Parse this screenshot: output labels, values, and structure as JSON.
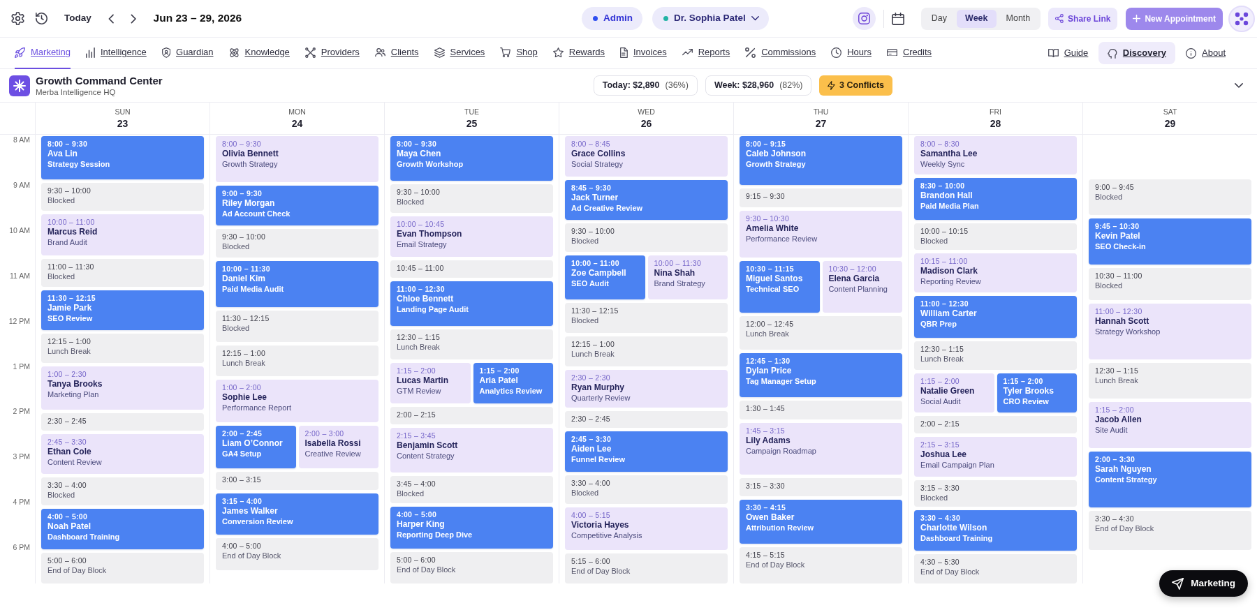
{
  "toolbar": {
    "today_button": "Today",
    "date_range": "Jun 23 – 29, 2026",
    "context_pills": [
      {
        "label": "Admin",
        "color": "#2f4ff0",
        "has_menu": false
      },
      {
        "label": "Dr. Sophia Patel",
        "color": "#22b3a4",
        "has_menu": true
      }
    ],
    "views": [
      {
        "label": "Day",
        "selected": false
      },
      {
        "label": "Week",
        "selected": true
      },
      {
        "label": "Month",
        "selected": false
      }
    ],
    "share_button": "Share Link",
    "new_button": {
      "label": "New Appointment",
      "disabled": true
    }
  },
  "nav": {
    "items": [
      {
        "label": "Marketing",
        "selected": true
      },
      {
        "label": "Intelligence",
        "selected": false
      },
      {
        "label": "Guardian",
        "selected": false
      },
      {
        "label": "Knowledge",
        "selected": false
      },
      {
        "label": "Providers",
        "selected": false
      },
      {
        "label": "Clients",
        "selected": false
      },
      {
        "label": "Services",
        "selected": false
      },
      {
        "label": "Shop",
        "selected": false
      },
      {
        "label": "Rewards",
        "selected": false
      },
      {
        "label": "Invoices",
        "selected": false
      },
      {
        "label": "Reports",
        "selected": false
      },
      {
        "label": "Commissions",
        "selected": false
      },
      {
        "label": "Hours",
        "selected": false
      },
      {
        "label": "Credits",
        "selected": false
      }
    ],
    "right_items": [
      {
        "label": "Guide",
        "highlighted": false
      },
      {
        "label": "Discovery",
        "highlighted": true
      },
      {
        "label": "About",
        "highlighted": false
      }
    ]
  },
  "page_header": {
    "title": "Growth Command Center",
    "subtitle": "Merba Intelligence HQ",
    "stats": [
      {
        "label": "Today: $2,890",
        "share": "(36%)"
      },
      {
        "label": "Week: $28,960",
        "share": "(82%)"
      }
    ],
    "conflicts": "3 Conflicts"
  },
  "time_labels": [
    "8 AM",
    "9 AM",
    "10 AM",
    "11 AM",
    "12 PM",
    "1 PM",
    "2 PM",
    "3 PM",
    "4 PM",
    "6 PM"
  ],
  "days": [
    {
      "weekday": "SUN",
      "date": "23",
      "events": [
        {
          "kind": "confirmed",
          "time": "8:00 – 9:30",
          "client": "Ava Lin",
          "service": "Strategy Session"
        },
        {
          "kind": "blocked",
          "time": "9:30 – 10:00",
          "note": "Blocked"
        },
        {
          "kind": "pending",
          "time": "10:00 – 11:00",
          "client": "Marcus Reid",
          "service": "Brand Audit"
        },
        {
          "kind": "blocked",
          "time": "11:00 – 11:30",
          "note": "Blocked"
        },
        {
          "kind": "confirmed",
          "time": "11:30 – 12:15",
          "client": "Jamie Park",
          "service": "SEO Review"
        },
        {
          "kind": "blocked",
          "time": "12:15 – 1:00",
          "note": "Lunch Break"
        },
        {
          "kind": "pending",
          "time": "1:00 – 2:30",
          "client": "Tanya Brooks",
          "service": "Marketing Plan"
        },
        {
          "kind": "blocked",
          "time": "2:30 – 2:45"
        },
        {
          "kind": "pending",
          "time": "2:45 – 3:30",
          "client": "Ethan Cole",
          "service": "Content Review"
        },
        {
          "kind": "blocked",
          "time": "3:30 – 4:00",
          "note": "Blocked"
        },
        {
          "kind": "confirmed",
          "time": "4:00 – 5:00",
          "client": "Noah Patel",
          "service": "Dashboard Training"
        },
        {
          "kind": "blocked",
          "time": "5:00 – 6:00",
          "note": "End of Day Block"
        }
      ]
    },
    {
      "weekday": "MON",
      "date": "24",
      "events": [
        {
          "kind": "pending",
          "time": "8:00 – 9:30",
          "client": "Olivia Bennett",
          "service": "Growth Strategy"
        },
        {
          "kind": "confirmed",
          "time": "9:00 – 9:30",
          "client": "Riley Morgan",
          "service": "Ad Account Check"
        },
        {
          "kind": "blocked",
          "time": "9:30 – 10:00",
          "note": "Blocked"
        },
        {
          "kind": "confirmed",
          "time": "10:00 – 11:30",
          "client": "Daniel Kim",
          "service": "Paid Media Audit"
        },
        {
          "kind": "blocked",
          "time": "11:30 – 12:15",
          "note": "Blocked"
        },
        {
          "kind": "blocked",
          "time": "12:15 – 1:00",
          "note": "Lunch Break"
        },
        {
          "kind": "pending",
          "time": "1:00 – 2:00",
          "client": "Sophie Lee",
          "service": "Performance Report"
        },
        {
          "kind": "side_by_side",
          "events": [
            {
              "kind": "confirmed",
              "time": "2:00 – 2:45",
              "client": "Liam O’Connor",
              "service": "GA4 Setup"
            },
            {
              "kind": "pending",
              "time": "2:00 – 3:00",
              "client": "Isabella Rossi",
              "service": "Creative Review"
            }
          ]
        },
        {
          "kind": "blocked",
          "time": "3:00 – 3:15"
        },
        {
          "kind": "confirmed",
          "time": "3:15 – 4:00",
          "client": "James Walker",
          "service": "Conversion Review"
        },
        {
          "kind": "blocked",
          "time": "4:00 – 5:00",
          "note": "End of Day Block"
        }
      ]
    },
    {
      "weekday": "TUE",
      "date": "25",
      "events": [
        {
          "kind": "confirmed",
          "time": "8:00 – 9:30",
          "client": "Maya Chen",
          "service": "Growth Workshop"
        },
        {
          "kind": "blocked",
          "time": "9:30 – 10:00",
          "note": "Blocked"
        },
        {
          "kind": "pending",
          "time": "10:00 – 10:45",
          "client": "Evan Thompson",
          "service": "Email Strategy"
        },
        {
          "kind": "blocked",
          "time": "10:45 – 11:00"
        },
        {
          "kind": "confirmed",
          "time": "11:00 – 12:30",
          "client": "Chloe Bennett",
          "service": "Landing Page Audit"
        },
        {
          "kind": "blocked",
          "time": "12:30 – 1:15",
          "note": "Lunch Break"
        },
        {
          "kind": "side_by_side",
          "events": [
            {
              "kind": "pending",
              "time": "1:15 – 2:00",
              "client": "Lucas Martin",
              "service": "GTM Review"
            },
            {
              "kind": "confirmed",
              "time": "1:15 – 2:00",
              "client": "Aria Patel",
              "service": "Analytics Review"
            }
          ]
        },
        {
          "kind": "blocked",
          "time": "2:00 – 2:15"
        },
        {
          "kind": "pending",
          "time": "2:15 – 3:45",
          "client": "Benjamin Scott",
          "service": "Content Strategy"
        },
        {
          "kind": "blocked",
          "time": "3:45 – 4:00",
          "note": "Blocked"
        },
        {
          "kind": "confirmed",
          "time": "4:00 – 5:00",
          "client": "Harper King",
          "service": "Reporting Deep Dive"
        },
        {
          "kind": "blocked",
          "time": "5:00 – 6:00",
          "note": "End of Day Block"
        }
      ]
    },
    {
      "weekday": "WED",
      "date": "26",
      "events": [
        {
          "kind": "pending",
          "time": "8:00 – 8:45",
          "client": "Grace Collins",
          "service": "Social Strategy"
        },
        {
          "kind": "confirmed",
          "time": "8:45 – 9:30",
          "client": "Jack Turner",
          "service": "Ad Creative Review"
        },
        {
          "kind": "blocked",
          "time": "9:30 – 10:00",
          "note": "Blocked"
        },
        {
          "kind": "side_by_side",
          "events": [
            {
              "kind": "confirmed",
              "time": "10:00 – 11:00",
              "client": "Zoe Campbell",
              "service": "SEO Audit"
            },
            {
              "kind": "pending",
              "time": "10:00 – 11:30",
              "client": "Nina Shah",
              "service": "Brand Strategy"
            }
          ]
        },
        {
          "kind": "blocked",
          "time": "11:30 – 12:15",
          "note": "Blocked"
        },
        {
          "kind": "blocked",
          "time": "12:15 – 1:00",
          "note": "Lunch Break"
        },
        {
          "kind": "pending",
          "time": "2:30 – 2:30",
          "client": "Ryan Murphy",
          "service": "Quarterly Review"
        },
        {
          "kind": "blocked",
          "time": "2:30 – 2:45"
        },
        {
          "kind": "confirmed",
          "time": "2:45 – 3:30",
          "client": "Aiden Lee",
          "service": "Funnel Review"
        },
        {
          "kind": "blocked",
          "time": "3:30 – 4:00",
          "note": "Blocked"
        },
        {
          "kind": "pending",
          "time": "4:00 – 5:15",
          "client": "Victoria Hayes",
          "service": "Competitive Analysis"
        },
        {
          "kind": "blocked",
          "time": "5:15 – 6:00",
          "note": "End of Day Block"
        }
      ]
    },
    {
      "weekday": "THU",
      "date": "27",
      "events": [
        {
          "kind": "confirmed",
          "time": "8:00 – 9:15",
          "client": "Caleb Johnson",
          "service": "Growth Strategy"
        },
        {
          "kind": "blocked",
          "time": "9:15 – 9:30"
        },
        {
          "kind": "pending",
          "time": "9:30 – 10:30",
          "client": "Amelia White",
          "service": "Performance Review"
        },
        {
          "kind": "side_by_side",
          "events": [
            {
              "kind": "confirmed",
              "time": "10:30 – 11:15",
              "client": "Miguel Santos",
              "service": "Technical SEO"
            },
            {
              "kind": "pending",
              "time": "10:30 – 12:00",
              "client": "Elena Garcia",
              "service": "Content Planning"
            }
          ]
        },
        {
          "kind": "blocked",
          "time": "12:00 – 12:45",
          "note": "Lunch Break"
        },
        {
          "kind": "confirmed",
          "time": "12:45 – 1:30",
          "client": "Dylan Price",
          "service": "Tag Manager Setup"
        },
        {
          "kind": "blocked",
          "time": "1:30 – 1:45"
        },
        {
          "kind": "pending",
          "time": "1:45 – 3:15",
          "client": "Lily Adams",
          "service": "Campaign Roadmap"
        },
        {
          "kind": "blocked",
          "time": "3:15 – 3:30"
        },
        {
          "kind": "confirmed",
          "time": "3:30 – 4:15",
          "client": "Owen Baker",
          "service": "Attribution Review"
        },
        {
          "kind": "blocked",
          "time": "4:15 – 5:15",
          "note": "End of Day Block"
        }
      ]
    },
    {
      "weekday": "FRI",
      "date": "28",
      "events": [
        {
          "kind": "pending",
          "time": "8:00 – 8:30",
          "client": "Samantha Lee",
          "service": "Weekly Sync"
        },
        {
          "kind": "confirmed",
          "time": "8:30 – 10:00",
          "client": "Brandon Hall",
          "service": "Paid Media Plan"
        },
        {
          "kind": "blocked",
          "time": "10:00 – 10:15",
          "note": "Blocked"
        },
        {
          "kind": "pending",
          "time": "10:15 – 11:00",
          "client": "Madison Clark",
          "service": "Reporting Review"
        },
        {
          "kind": "confirmed",
          "time": "11:00 – 12:30",
          "client": "William Carter",
          "service": "QBR Prep"
        },
        {
          "kind": "blocked",
          "time": "12:30 – 1:15",
          "note": "Lunch Break"
        },
        {
          "kind": "side_by_side",
          "events": [
            {
              "kind": "pending",
              "time": "1:15 – 2:00",
              "client": "Natalie Green",
              "service": "Social Audit"
            },
            {
              "kind": "confirmed",
              "time": "1:15 – 2:00",
              "client": "Tyler Brooks",
              "service": "CRO Review"
            }
          ]
        },
        {
          "kind": "blocked",
          "time": "2:00 – 2:15"
        },
        {
          "kind": "pending",
          "time": "2:15 – 3:15",
          "client": "Joshua Lee",
          "service": "Email Campaign Plan"
        },
        {
          "kind": "blocked",
          "time": "3:15 – 3:30",
          "note": "Blocked"
        },
        {
          "kind": "confirmed",
          "time": "3:30 – 4:30",
          "client": "Charlotte Wilson",
          "service": "Dashboard Training"
        },
        {
          "kind": "blocked",
          "time": "4:30 – 5:30",
          "note": "End of Day Block"
        }
      ]
    },
    {
      "weekday": "SAT",
      "date": "29",
      "events": [
        {
          "kind": "blocked",
          "time": "9:00 – 9:45",
          "note": "Blocked"
        },
        {
          "kind": "confirmed",
          "time": "9:45 – 10:30",
          "client": "Kevin Patel",
          "service": "SEO Check-in"
        },
        {
          "kind": "blocked",
          "time": "10:30 – 11:00",
          "note": "Blocked"
        },
        {
          "kind": "pending",
          "time": "11:00 – 12:30",
          "client": "Hannah Scott",
          "service": "Strategy Workshop"
        },
        {
          "kind": "blocked",
          "time": "12:30 – 1:15",
          "note": "Lunch Break"
        },
        {
          "kind": "pending",
          "time": "1:15 – 2:00",
          "client": "Jacob Allen",
          "service": "Site Audit"
        },
        {
          "kind": "confirmed",
          "time": "2:00 – 3:30",
          "client": "Sarah Nguyen",
          "service": "Content Strategy"
        },
        {
          "kind": "blocked",
          "time": "3:30 – 4:30",
          "note": "End of Day Block"
        }
      ]
    }
  ],
  "floating_button": "Marketing"
}
